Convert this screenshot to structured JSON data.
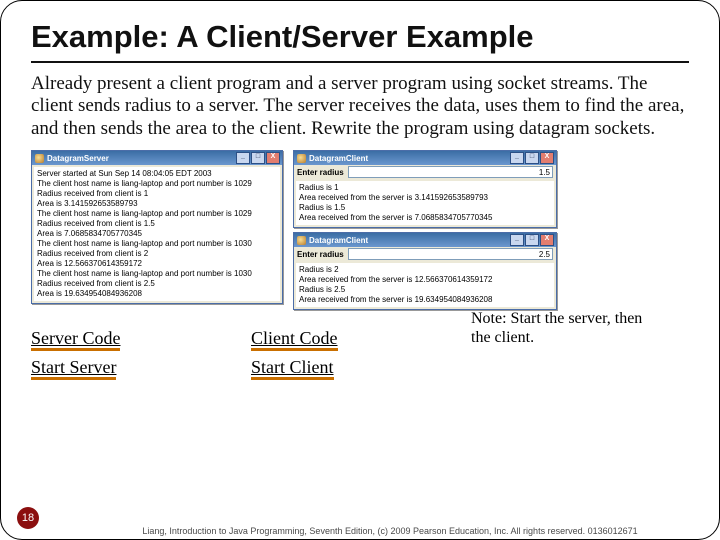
{
  "title": "Example: A Client/Server Example",
  "body": "Already present a client program and a server program using socket streams. The client sends radius to a server. The server receives the data, uses them to find the area, and then sends the area to the client. Rewrite the program using datagram sockets.",
  "server_win": {
    "title": "DatagramServer",
    "lines": [
      "Server started at Sun Sep 14 08:04:05 EDT 2003",
      "The client host name is liang-laptop and port number is 1029",
      "Radius received from client is 1",
      "Area is 3.141592653589793",
      "The client host name is liang-laptop and port number is 1029",
      "Radius received from client is 1.5",
      "Area is 7.0685834705770345",
      "The client host name is liang-laptop and port number is 1030",
      "Radius received from client is 2",
      "Area is 12.566370614359172",
      "The client host name is liang-laptop and port number is 1030",
      "Radius received from client is 2.5",
      "Area is 19.634954084936208"
    ]
  },
  "client1": {
    "title": "DatagramClient",
    "label": "Enter radius",
    "input": "1.5",
    "lines": [
      "Radius is 1",
      "Area received from the server is 3.141592653589793",
      "Radius is 1.5",
      "Area received from the server is 7.0685834705770345"
    ]
  },
  "client2": {
    "title": "DatagramClient",
    "label": "Enter radius",
    "input": "2.5",
    "lines": [
      "Radius is 2",
      "Area received from the server is 12.566370614359172",
      "Radius is 2.5",
      "Area received from the server is 19.634954084936208"
    ]
  },
  "win_buttons": {
    "min": "_",
    "max": "□",
    "close": "X"
  },
  "links": {
    "server_code": "Server Code",
    "start_server": "Start Server",
    "client_code": "Client Code",
    "start_client": "Start Client"
  },
  "note": "Note: Start the server, then the client.",
  "page": "18",
  "footer": "Liang, Introduction to Java Programming, Seventh Edition, (c) 2009 Pearson Education, Inc. All rights reserved. 0136012671"
}
